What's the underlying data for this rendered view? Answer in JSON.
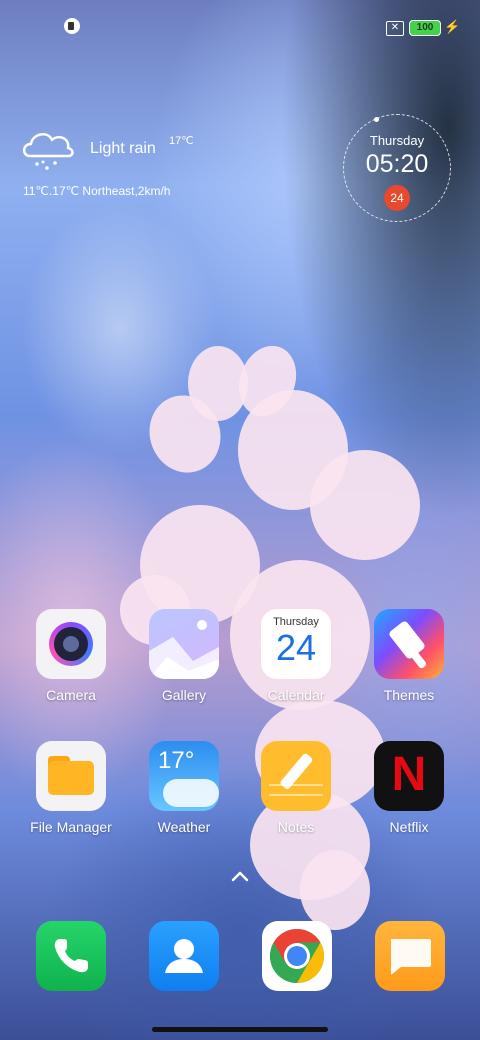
{
  "status_bar": {
    "battery": "100",
    "sim_icon": "no-sim-icon",
    "charge_icon": "charging-bolt-icon"
  },
  "weather_widget": {
    "condition": "Light rain",
    "temperature": "17℃",
    "detail": "11℃.17℃ Northeast,2km/h",
    "icon": "rain-cloud-icon"
  },
  "clock_widget": {
    "day": "Thursday",
    "time": "05:20",
    "date": "24"
  },
  "apps": [
    {
      "label": "Camera",
      "icon": "camera-icon"
    },
    {
      "label": "Gallery",
      "icon": "gallery-icon"
    },
    {
      "label": "Calendar",
      "icon": "calendar-icon",
      "icon_day": "Thursday",
      "icon_date": "24"
    },
    {
      "label": "Themes",
      "icon": "themes-icon"
    },
    {
      "label": "File Manager",
      "icon": "folder-icon"
    },
    {
      "label": "Weather",
      "icon": "weather-icon",
      "icon_temp": "17°"
    },
    {
      "label": "Notes",
      "icon": "notes-icon"
    },
    {
      "label": "Netflix",
      "icon": "netflix-icon",
      "icon_letter": "N"
    }
  ],
  "dock": [
    {
      "icon": "phone-icon"
    },
    {
      "icon": "contacts-icon"
    },
    {
      "icon": "chrome-icon"
    },
    {
      "icon": "messages-icon"
    }
  ],
  "colors": {
    "battery_fill": "#45d14c",
    "date_badge": "#e6492d",
    "calendar_blue": "#1e6fe0",
    "netflix_red": "#e50914"
  }
}
